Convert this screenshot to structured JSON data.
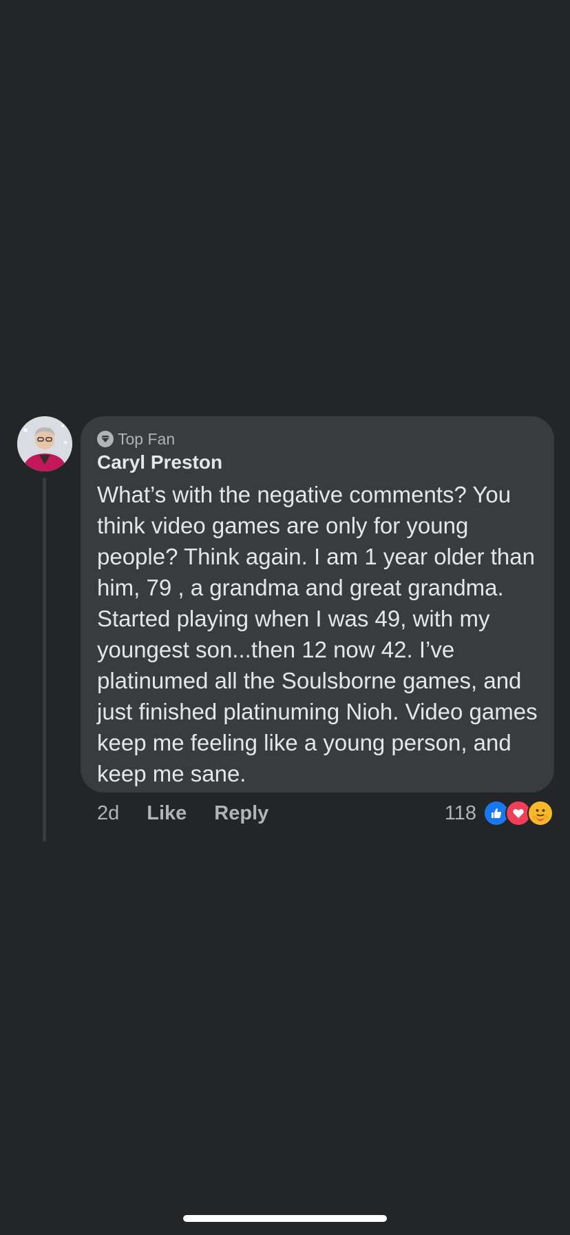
{
  "comment": {
    "author": "Caryl Preston",
    "badge": "Top Fan",
    "badge_icon": "diamond-icon",
    "avatar": "user-avatar",
    "text": "What’s with the negative comments? You think video games are only for young people? Think again. I am 1 year older than him, 79 , a grandma and great grandma. Started playing when I was 49, with my youngest son...then 12 now 42. I’ve platinumed all the Soulsborne games, and just finished platinuming Nioh. Video games keep me feeling like a young person, and keep me sane.",
    "time": "2d",
    "like_label": "Like",
    "reply_label": "Reply",
    "reaction_count": "118",
    "reactions": [
      "like-reaction-icon",
      "love-reaction-icon",
      "care-reaction-icon"
    ]
  },
  "colors": {
    "background": "#242526",
    "bubble": "#3a3b3c",
    "text_primary": "#e4e6eb",
    "text_secondary": "#b0b3b8",
    "like": "#1877f2",
    "love": "#f33e58",
    "care": "#f7b928"
  }
}
